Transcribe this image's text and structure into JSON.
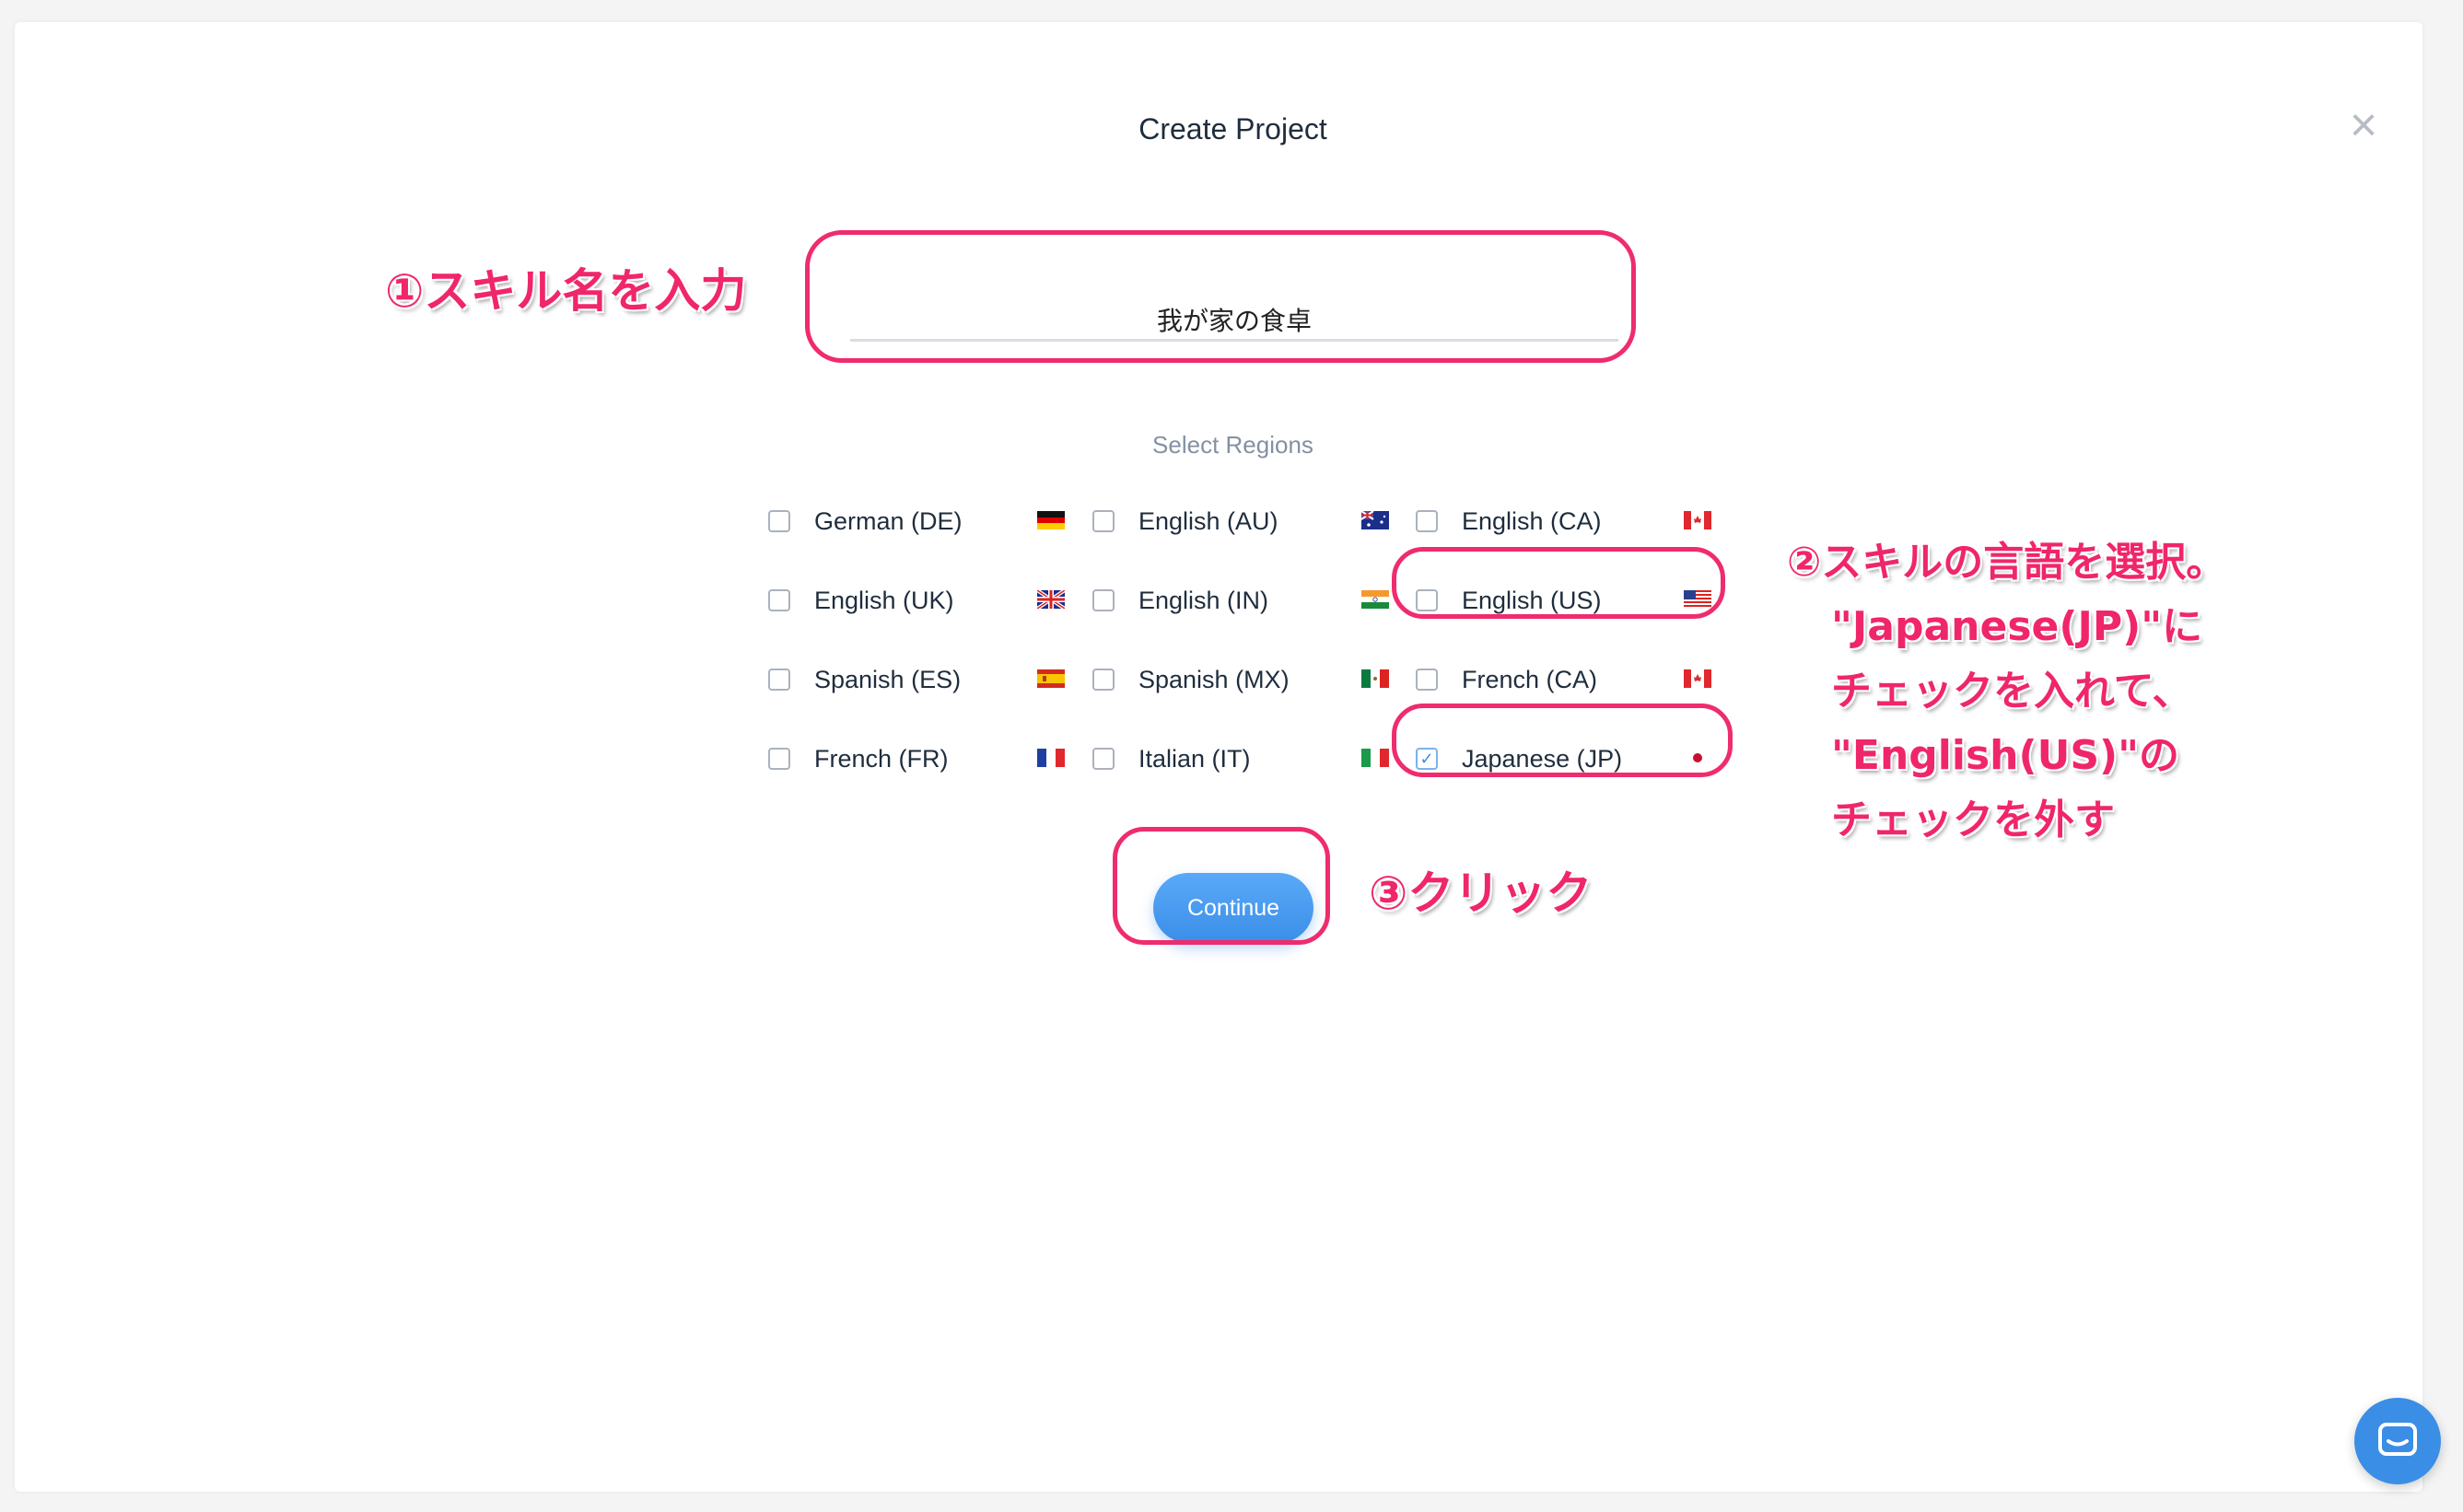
{
  "modal": {
    "title": "Create Project",
    "close_symbol": "×",
    "project_name_value": "我が家の食卓",
    "select_regions_label": "Select Regions",
    "continue_label": "Continue"
  },
  "regions": [
    {
      "label": "German (DE)",
      "checked": false,
      "flag": "de-flag-icon"
    },
    {
      "label": "English (AU)",
      "checked": false,
      "flag": "au-flag-icon"
    },
    {
      "label": "English (CA)",
      "checked": false,
      "flag": "ca-flag-icon"
    },
    {
      "label": "English (UK)",
      "checked": false,
      "flag": "uk-flag-icon"
    },
    {
      "label": "English (IN)",
      "checked": false,
      "flag": "in-flag-icon"
    },
    {
      "label": "English (US)",
      "checked": false,
      "flag": "us-flag-icon"
    },
    {
      "label": "Spanish (ES)",
      "checked": false,
      "flag": "es-flag-icon"
    },
    {
      "label": "Spanish (MX)",
      "checked": false,
      "flag": "mx-flag-icon"
    },
    {
      "label": "French (CA)",
      "checked": false,
      "flag": "ca-flag-icon"
    },
    {
      "label": "French (FR)",
      "checked": false,
      "flag": "fr-flag-icon"
    },
    {
      "label": "Italian (IT)",
      "checked": false,
      "flag": "it-flag-icon"
    },
    {
      "label": "Japanese (JP)",
      "checked": true,
      "flag": "jp-flag-icon"
    }
  ],
  "annotations": {
    "step1": "①スキル名を入力",
    "step2_lines": [
      "②スキルの言語を選択。",
      "\"Japanese(JP)\"に",
      "チェックを入れて、",
      "\"English(US)\"の",
      "チェックを外す"
    ],
    "step3": "③クリック"
  },
  "colors": {
    "accent": "#3b8ee8",
    "annotation": "#f0266a",
    "chat": "#3a8ee6"
  }
}
